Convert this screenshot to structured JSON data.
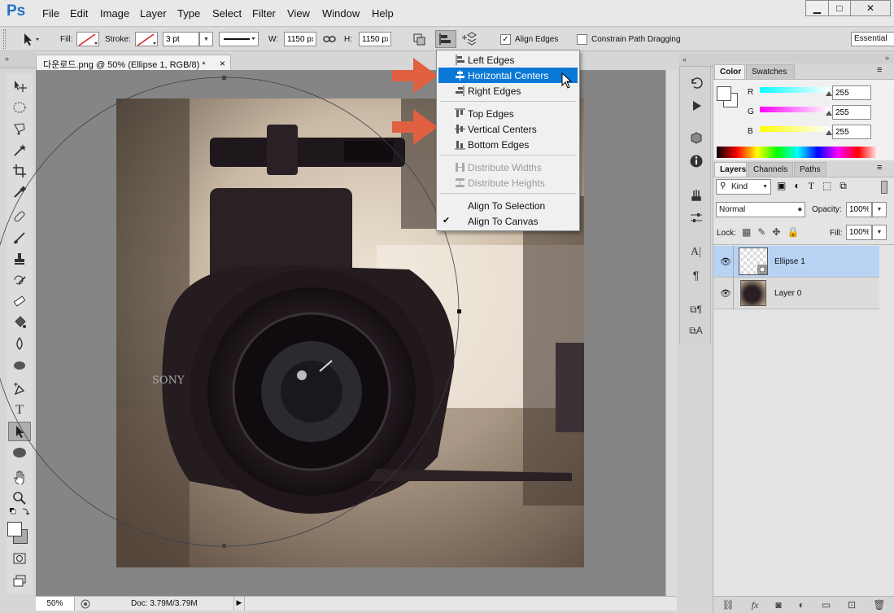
{
  "app": {
    "logo": "Ps"
  },
  "menu": [
    "File",
    "Edit",
    "Image",
    "Layer",
    "Type",
    "Select",
    "Filter",
    "View",
    "Window",
    "Help"
  ],
  "window_controls": {
    "minimize": "▁",
    "maximize": "□",
    "close": "✕"
  },
  "options": {
    "fill_label": "Fill:",
    "stroke_label": "Stroke:",
    "stroke_width": "3 pt",
    "w_label": "W:",
    "w_value": "1150 px",
    "h_label": "H:",
    "h_value": "1150 px",
    "align_edges_label": "Align Edges",
    "align_edges_checked": true,
    "constrain_label": "Constrain Path Dragging",
    "constrain_checked": false,
    "workspace": "Essential"
  },
  "document": {
    "tab_title": "다운로드.png @ 50% (Ellipse 1, RGB/8) *",
    "close": "×"
  },
  "align_menu": {
    "items": [
      {
        "label": "Left Edges",
        "enabled": true,
        "highlighted": false,
        "icon": "align-left-edges-icon"
      },
      {
        "label": "Horizontal Centers",
        "enabled": true,
        "highlighted": true,
        "icon": "align-horizontal-centers-icon"
      },
      {
        "label": "Right Edges",
        "enabled": true,
        "highlighted": false,
        "icon": "align-right-edges-icon"
      },
      {
        "label": "Top Edges",
        "enabled": true,
        "highlighted": false,
        "icon": "align-top-edges-icon"
      },
      {
        "label": "Vertical Centers",
        "enabled": true,
        "highlighted": false,
        "icon": "align-vertical-centers-icon"
      },
      {
        "label": "Bottom Edges",
        "enabled": true,
        "highlighted": false,
        "icon": "align-bottom-edges-icon"
      },
      {
        "label": "Distribute Widths",
        "enabled": false,
        "highlighted": false,
        "icon": "distribute-widths-icon"
      },
      {
        "label": "Distribute Heights",
        "enabled": false,
        "highlighted": false,
        "icon": "distribute-heights-icon"
      },
      {
        "label": "Align To Selection",
        "enabled": true,
        "checked": false
      },
      {
        "label": "Align To Canvas",
        "enabled": true,
        "checked": true
      }
    ]
  },
  "photo": {
    "brand": "SONY"
  },
  "status": {
    "zoom": "50%",
    "doc": "Doc: 3.79M/3.79M"
  },
  "color_panel": {
    "tabs": [
      "Color",
      "Swatches"
    ],
    "r_label": "R",
    "g_label": "G",
    "b_label": "B",
    "r": "255",
    "g": "255",
    "b": "255"
  },
  "layers_panel": {
    "tabs": [
      "Layers",
      "Channels",
      "Paths"
    ],
    "filter_kind": "Kind",
    "blend_mode": "Normal",
    "opacity_label": "Opacity:",
    "opacity": "100%",
    "lock_label": "Lock:",
    "fill_label": "Fill:",
    "fill": "100%",
    "layers": [
      {
        "name": "Ellipse 1",
        "selected": true,
        "visible": true
      },
      {
        "name": "Layer 0",
        "selected": false,
        "visible": true
      }
    ]
  },
  "colors": {
    "accent": "#0a78d7",
    "arrow": "#e0603f",
    "selected_layer": "#b8d2f4"
  }
}
